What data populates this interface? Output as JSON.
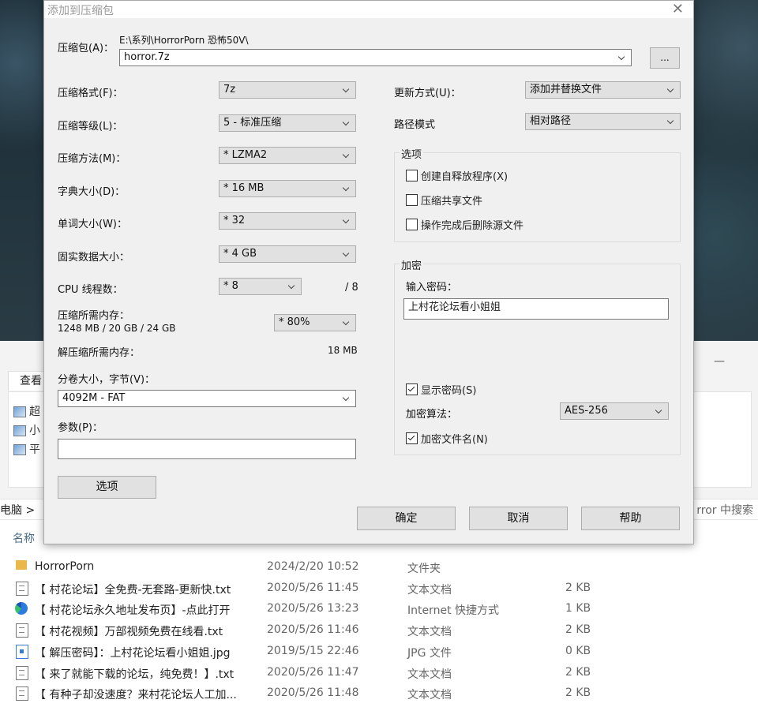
{
  "dialog": {
    "title": "添加到压缩包",
    "archive_label": "压缩包(A)：",
    "archive_path": "E:\\系列\\HorrorPorn 恐怖50V\\",
    "archive_name": "horror.7z",
    "browse_label": "...",
    "format_label": "压缩格式(F)：",
    "format_value": "7z",
    "level_label": "压缩等级(L)：",
    "level_value": "5 - 标准压缩",
    "method_label": "压缩方法(M)：",
    "method_value": "* LZMA2",
    "dict_label": "字典大小(D)：",
    "dict_value": "* 16 MB",
    "word_label": "单词大小(W)：",
    "word_value": "* 32",
    "solid_label": "固实数据大小：",
    "solid_value": "* 4 GB",
    "cpu_label": "CPU 线程数：",
    "cpu_value": "* 8",
    "cpu_max": "/ 8",
    "mem_label": "压缩所需内存：",
    "mem_detail": "1248 MB / 20 GB / 24 GB",
    "mem_value": "* 80%",
    "decomp_label": "解压缩所需内存：",
    "decomp_value": "18 MB",
    "split_label": "分卷大小，字节(V)：",
    "split_value": "4092M - FAT",
    "params_label": "参数(P)：",
    "params_value": "",
    "options_button": "选项",
    "update_label": "更新方式(U)：",
    "update_value": "添加并替换文件",
    "path_label": "路径模式",
    "path_value": "相对路径",
    "options_group": "选项",
    "opt_sfx": "创建自释放程序(X)",
    "opt_shared": "压缩共享文件",
    "opt_delete": "操作完成后删除源文件",
    "encrypt_group": "加密",
    "password_label": "输入密码：",
    "password_value": "上村花论坛看小姐姐",
    "show_password": "显示密码(S)",
    "enc_method_label": "加密算法：",
    "enc_method_value": "AES-256",
    "encrypt_names": "加密文件名(N)",
    "ok": "确定",
    "cancel": "取消",
    "help": "帮助"
  },
  "explorer": {
    "tab_view": "查看",
    "ribbon_items": [
      "超",
      "小",
      "平"
    ],
    "breadcrumb": "电脑 >",
    "search_placeholder": "rror 中搜索",
    "col_name": "名称",
    "files": [
      {
        "icon": "folder-icon",
        "name": "HorrorPorn",
        "date": "2024/2/20 10:52",
        "type": "文件夹",
        "size": ""
      },
      {
        "icon": "text-file-icon",
        "name": "【 村花论坛】全免费-无套路-更新快.txt",
        "date": "2020/5/26 11:45",
        "type": "文本文档",
        "size": "2 KB"
      },
      {
        "icon": "edge-icon",
        "name": "【 村花论坛永久地址发布页】-点此打开",
        "date": "2020/5/26 13:23",
        "type": "Internet 快捷方式",
        "size": "1 KB"
      },
      {
        "icon": "text-file-icon",
        "name": "【 村花视频】万部视频免费在线看.txt",
        "date": "2020/5/26 11:46",
        "type": "文本文档",
        "size": "2 KB"
      },
      {
        "icon": "image-file-icon",
        "name": "【 解压密码】：上村花论坛看小姐姐.jpg",
        "date": "2019/5/15 22:46",
        "type": "JPG 文件",
        "size": "0 KB"
      },
      {
        "icon": "text-file-icon",
        "name": "【 来了就能下载的论坛，纯免费！】.txt",
        "date": "2020/5/26 11:47",
        "type": "文本文档",
        "size": "2 KB"
      },
      {
        "icon": "text-file-icon",
        "name": "【 有种子却没速度？来村花论坛人工加...",
        "date": "2020/5/26 11:48",
        "type": "文本文档",
        "size": "2 KB"
      }
    ]
  }
}
